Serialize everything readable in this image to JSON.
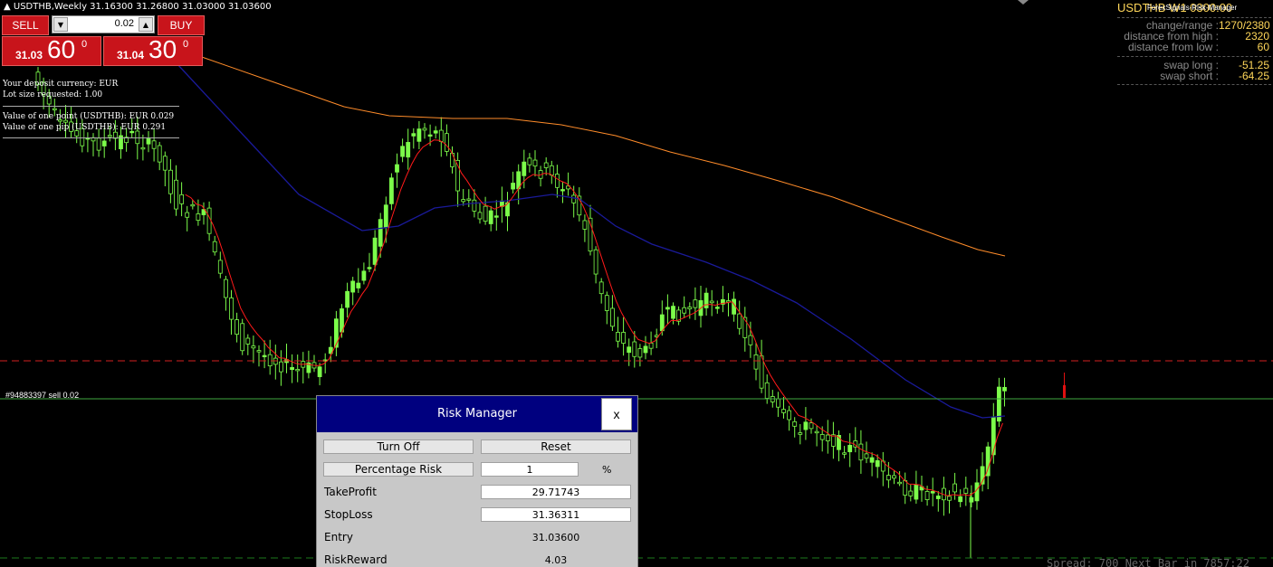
{
  "chart": {
    "title_line": "USDTHB,Weekly  31.16300 31.26800 31.03000 31.03600",
    "colors": {
      "background": "#000000",
      "candle": "#7cfc4a",
      "ma_fast": "#ff1a1a",
      "ma_mid": "#1a1a9a",
      "ma_slow": "#ff8c2a",
      "level_dashed": "#d42020",
      "order_line": "#3fa83f",
      "bottom_dashed": "#1c7a1c"
    }
  },
  "one_click": {
    "sell_label": "SELL",
    "buy_label": "BUY",
    "lot_value": "0.02",
    "lot_down_icon": "triangle-down-icon",
    "lot_up_icon": "triangle-up-icon",
    "sell_price_small": "31.03",
    "sell_price_big": "60",
    "sell_price_sup": "0",
    "buy_price_small": "31.04",
    "buy_price_big": "30",
    "buy_price_sup": "0"
  },
  "info": {
    "line1": "Your deposit currency: EUR",
    "line2": "Lot size requested: 1.00",
    "line3": "Value of one point (USDTHB): EUR 0.029",
    "line4": "Value of one pip  (USDTHB): EUR 0.291"
  },
  "order_label": "#94883397 sell 0.02",
  "right_panel": {
    "title": "USDTHB  W1  0300:00",
    "indicator_name": "ForexSignals-Risk-Manager",
    "rows": [
      {
        "label": "change/range :",
        "value": "1270/2380"
      },
      {
        "label": "distance from high :",
        "value": "2320"
      },
      {
        "label": "distance from low :",
        "value": "60"
      },
      {
        "label": "swap long :",
        "value": "-51.25"
      },
      {
        "label": "swap short :",
        "value": "-64.25"
      }
    ]
  },
  "bottom_status": "Spread: 700  Next Bar in 7857:22",
  "risk_manager": {
    "title": "Risk Manager",
    "close_label": "x",
    "turn_off_label": "Turn Off",
    "reset_label": "Reset",
    "percentage_risk_label": "Percentage Risk",
    "percentage_value": "1",
    "percent_sign": "%",
    "take_profit_label": "TakeProfit",
    "take_profit_value": "29.71743",
    "stop_loss_label": "StopLoss",
    "stop_loss_value": "31.36311",
    "entry_label": "Entry",
    "entry_value": "31.03600",
    "risk_reward_label": "RiskReward",
    "risk_reward_value": "4.03"
  }
}
